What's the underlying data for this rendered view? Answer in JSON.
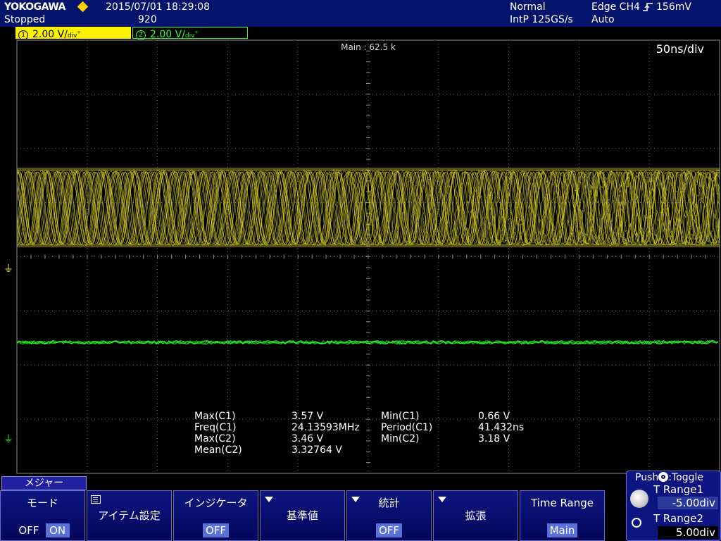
{
  "header": {
    "brand": "YOKOGAWA",
    "status": "Stopped",
    "datetime": "2015/07/01  18:29:08",
    "record_count": "920",
    "acq_mode": "Normal",
    "sample_rate": "IntP  125GS/s",
    "trigger_source": "Edge CH4",
    "trigger_slope_icon": "rising-edge-icon",
    "trigger_level": "156mV",
    "trigger_mode": "Auto"
  },
  "channels": [
    {
      "num": "1",
      "scale": "2.00 V/",
      "unit": "div",
      "color": "#fff200"
    },
    {
      "num": "2",
      "scale": "2.00 V/",
      "unit": "div",
      "color": "#2cff2c"
    }
  ],
  "display": {
    "main_label": "Main : 62.5 k",
    "timebase": "50ns/div",
    "ground_marker_icon": "ground-icon"
  },
  "measurements": [
    {
      "l1": "Max(C1)",
      "v1": "3.57 V",
      "l2": "Min(C1)",
      "v2": "0.66 V"
    },
    {
      "l1": "Freq(C1)",
      "v1": "24.13593MHz",
      "l2": "Period(C1)",
      "v2": "41.432ns"
    },
    {
      "l1": "Max(C2)",
      "v1": "3.46 V",
      "l2": "Min(C2)",
      "v2": "3.18 V"
    },
    {
      "l1": "Mean(C2)",
      "v1": "3.32764 V",
      "l2": "",
      "v2": ""
    }
  ],
  "menu": {
    "tab": "メジャー",
    "softkeys": {
      "mode": {
        "label": "モード",
        "off": "OFF",
        "on": "ON"
      },
      "item": {
        "label": "アイテム設定"
      },
      "indicator": {
        "label": "インジケータ",
        "value": "OFF"
      },
      "reference": {
        "label": "基準値"
      },
      "stats": {
        "label": "統計",
        "value": "OFF"
      },
      "expand": {
        "label": "拡張"
      },
      "timerange": {
        "label": "Time Range",
        "value": "Main"
      }
    }
  },
  "jog": {
    "title": "Push",
    "title_suffix": ":Toggle",
    "t1_label": "T Range1",
    "t1_value": "-5.00div",
    "t2_label": "T Range2",
    "t2_value": "5.00div"
  },
  "colors": {
    "background": "#000000",
    "header": "#04146a",
    "ch1": "#fff200",
    "ch2": "#2cff2c",
    "softkey": "#0d1580",
    "highlight": "#5a72d8"
  }
}
